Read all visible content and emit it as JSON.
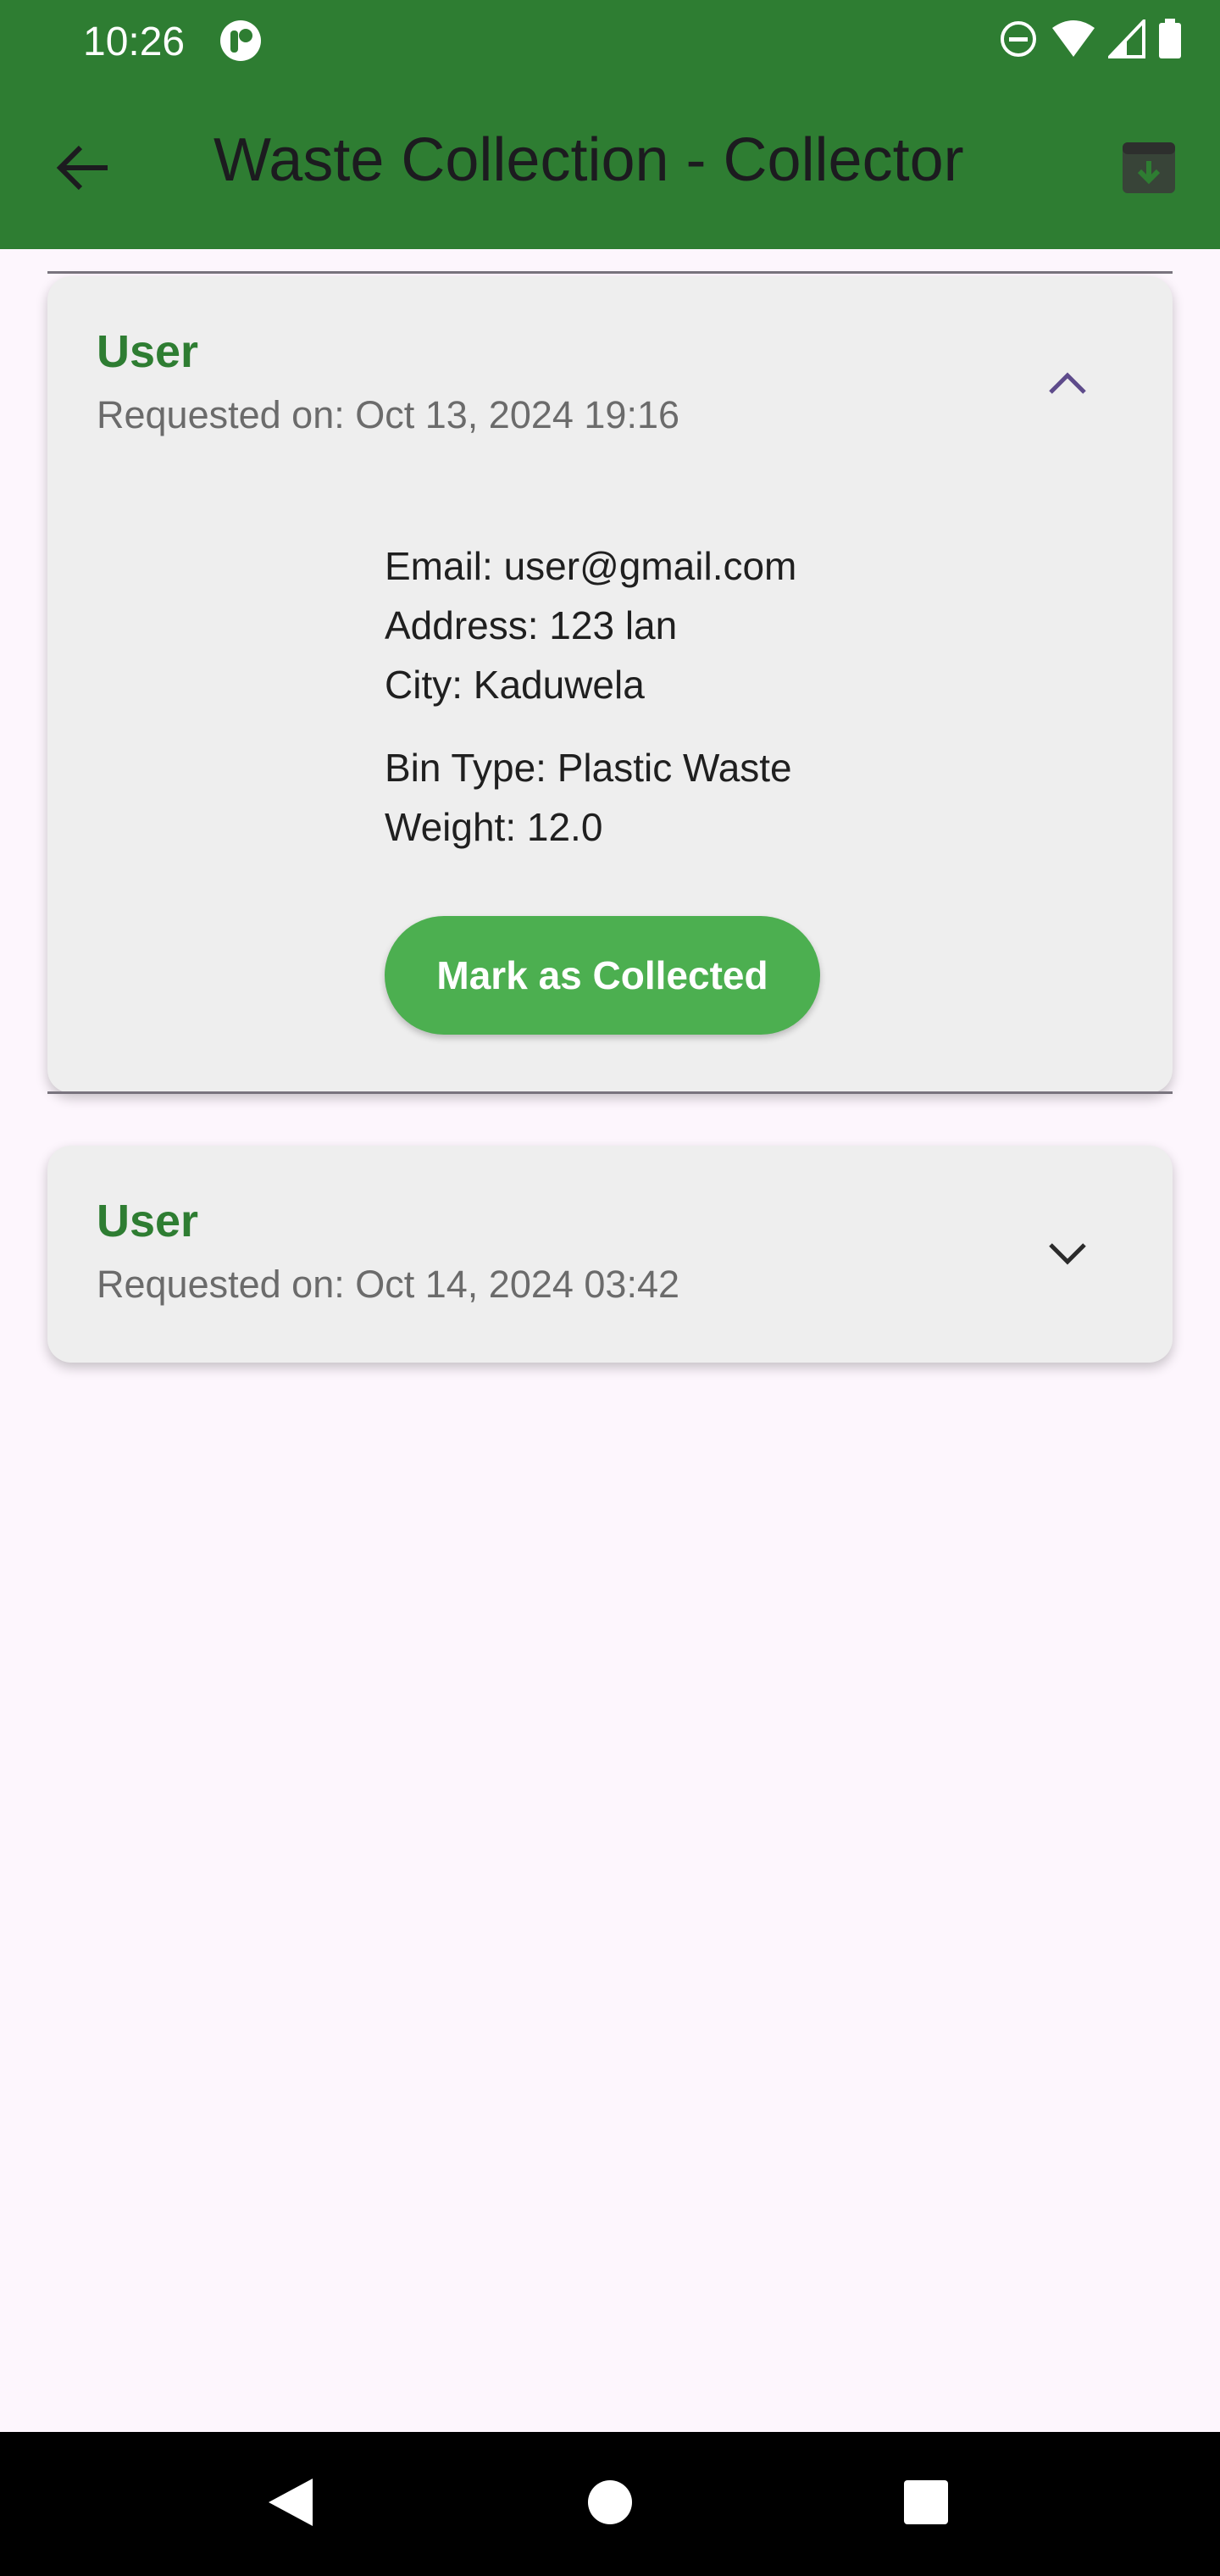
{
  "status_bar": {
    "time": "10:26",
    "icons": [
      "app-notification-icon",
      "do-not-disturb-icon",
      "wifi-icon",
      "signal-icon",
      "battery-icon"
    ]
  },
  "app_bar": {
    "title": "Waste Collection - Collector",
    "back_icon": "arrow-back-icon",
    "action_icon": "archive-icon",
    "color": "#2e7d32"
  },
  "requests": [
    {
      "name": "User",
      "requested_on": "Requested on: Oct 13, 2024 19:16",
      "expanded": true,
      "email": "Email: user@gmail.com",
      "address": "Address: 123 lan",
      "city": "City: Kaduwela",
      "bin_type": "Bin Type: Plastic Waste",
      "weight": "Weight: 12.0",
      "button_label": "Mark as Collected"
    },
    {
      "name": "User",
      "requested_on": "Requested on: Oct 14, 2024 03:42",
      "expanded": false
    }
  ],
  "colors": {
    "accent_green": "#2e7d32",
    "button_green": "#4caf50",
    "card_background": "#eeeeee",
    "page_background": "#fdf6fd",
    "expanded_chevron": "#5e4b8b"
  },
  "nav_bar": {
    "icons": [
      "nav-back-icon",
      "nav-home-icon",
      "nav-recents-icon"
    ]
  }
}
